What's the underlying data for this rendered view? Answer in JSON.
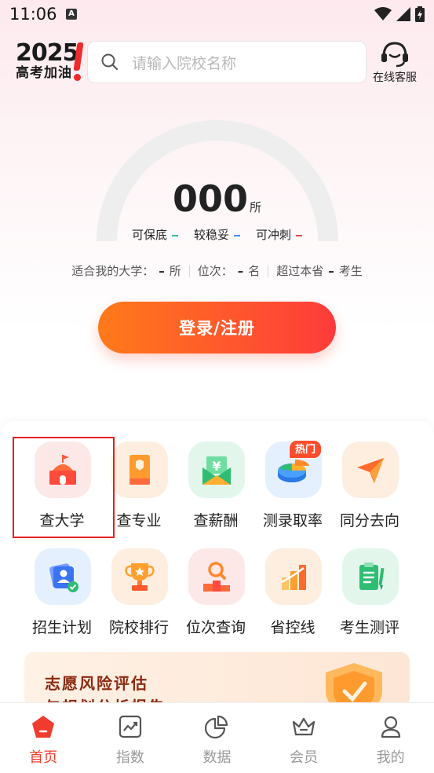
{
  "status_bar": {
    "time": "11:06",
    "a_badge": "A"
  },
  "header": {
    "logo_year": "2025",
    "logo_slogan": "高考加油",
    "search_placeholder": "请输入院校名称",
    "service_label": "在线客服"
  },
  "gauge": {
    "count": "000",
    "unit": "所",
    "legend": [
      {
        "label": "可保底",
        "color": "#2ac29a"
      },
      {
        "label": "较稳妥",
        "color": "#3a8ef6"
      },
      {
        "label": "可冲刺",
        "color": "#f04848"
      }
    ]
  },
  "stats": {
    "fit_label": "适合我的大学：",
    "fit_value": "–",
    "fit_unit": "所",
    "rank_label": "位次：",
    "rank_value": "–",
    "rank_unit": "名",
    "exceed_label": "超过本省",
    "exceed_value": "–",
    "exceed_unit": "考生"
  },
  "login_button": "登录/注册",
  "features": [
    {
      "label": "查大学",
      "icon": "school-icon"
    },
    {
      "label": "查专业",
      "icon": "book-icon"
    },
    {
      "label": "查薪酬",
      "icon": "salary-envelope-icon"
    },
    {
      "label": "测录取率",
      "icon": "pie-chart-icon",
      "badge": "热门"
    },
    {
      "label": "同分去向",
      "icon": "paper-plane-icon"
    },
    {
      "label": "招生计划",
      "icon": "enrollment-plan-icon"
    },
    {
      "label": "院校排行",
      "icon": "trophy-icon"
    },
    {
      "label": "位次查询",
      "icon": "rank-search-icon"
    },
    {
      "label": "省控线",
      "icon": "bar-chart-icon"
    },
    {
      "label": "考生测评",
      "icon": "clipboard-icon"
    }
  ],
  "banner": {
    "title": "志愿风险评估",
    "subtitle": "与规划分析报告"
  },
  "bottom_nav": [
    {
      "label": "首页",
      "icon": "home-icon",
      "active": true
    },
    {
      "label": "指数",
      "icon": "index-chart-icon",
      "active": false
    },
    {
      "label": "数据",
      "icon": "data-pie-icon",
      "active": false
    },
    {
      "label": "会员",
      "icon": "crown-icon",
      "active": false
    },
    {
      "label": "我的",
      "icon": "profile-icon",
      "active": false
    }
  ],
  "colors": {
    "accent": "#f03c2e",
    "button_start": "#ff7a1a",
    "button_end": "#ff3b3b"
  }
}
